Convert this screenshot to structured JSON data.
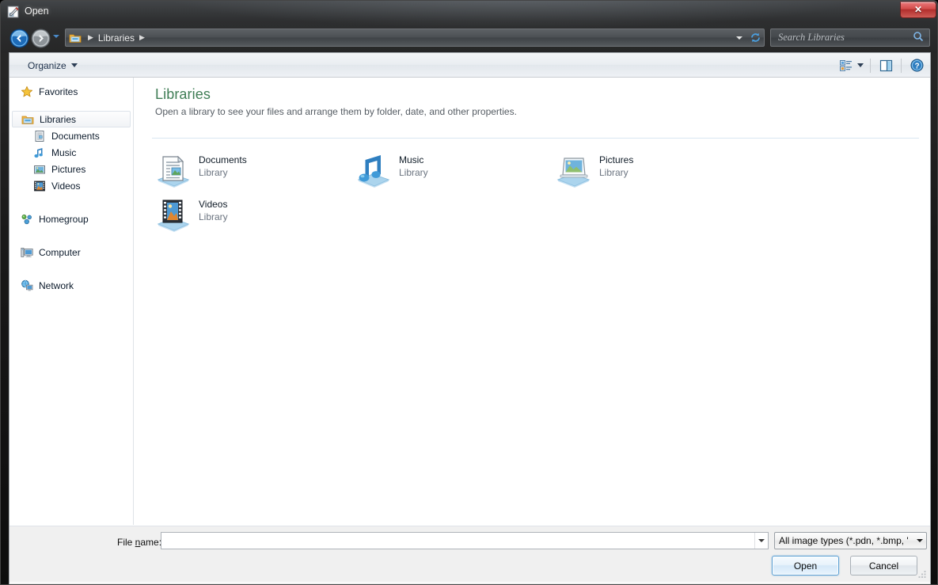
{
  "window": {
    "title": "Open",
    "title_icon": "paint-dot-net-icon",
    "close_label": "✕"
  },
  "navigation": {
    "back_icon": "back-arrow-icon",
    "forward_icon": "forward-arrow-icon",
    "history_dropdown_icon": "chevron-down-icon",
    "breadcrumb_folder_icon": "library-folder-icon",
    "breadcrumb": [
      {
        "label": "Libraries"
      }
    ],
    "separator": "▶",
    "address_dropdown_icon": "chevron-down-icon",
    "refresh_icon": "refresh-icon"
  },
  "search": {
    "placeholder": "Search Libraries",
    "value": "",
    "icon": "search-icon"
  },
  "toolbar": {
    "organize_label": "Organize",
    "organize_caret_icon": "chevron-down-icon",
    "view_icon": "change-view-icon",
    "view_caret_icon": "chevron-down-icon",
    "preview_pane_icon": "preview-pane-icon",
    "help_icon": "help-icon"
  },
  "sidebar": {
    "items": [
      {
        "label": "Favorites",
        "icon": "star-icon",
        "level": 0,
        "selected": false,
        "gap_before": false
      },
      {
        "label": "Libraries",
        "icon": "library-folder-icon",
        "level": 0,
        "selected": true,
        "gap_before": true
      },
      {
        "label": "Documents",
        "icon": "documents-library-icon",
        "level": 1,
        "selected": false,
        "gap_before": false
      },
      {
        "label": "Music",
        "icon": "music-library-icon",
        "level": 1,
        "selected": false,
        "gap_before": false
      },
      {
        "label": "Pictures",
        "icon": "pictures-library-icon",
        "level": 1,
        "selected": false,
        "gap_before": false
      },
      {
        "label": "Videos",
        "icon": "videos-library-icon",
        "level": 1,
        "selected": false,
        "gap_before": false
      },
      {
        "label": "Homegroup",
        "icon": "homegroup-icon",
        "level": 0,
        "selected": false,
        "gap_before": true
      },
      {
        "label": "Computer",
        "icon": "computer-icon",
        "level": 0,
        "selected": false,
        "gap_before": true
      },
      {
        "label": "Network",
        "icon": "network-icon",
        "level": 0,
        "selected": false,
        "gap_before": true
      }
    ]
  },
  "content": {
    "heading": "Libraries",
    "heading_color": "#3f7d55",
    "subheading": "Open a library to see your files and arrange them by folder, date, and other properties.",
    "items": [
      {
        "name": "Documents",
        "kind": "Library",
        "icon": "documents-library-icon"
      },
      {
        "name": "Music",
        "kind": "Library",
        "icon": "music-library-icon"
      },
      {
        "name": "Pictures",
        "kind": "Library",
        "icon": "pictures-library-icon"
      },
      {
        "name": "Videos",
        "kind": "Library",
        "icon": "videos-library-icon"
      }
    ]
  },
  "footer": {
    "filename_label_before": "File ",
    "filename_label_accel": "n",
    "filename_label_after": "ame:",
    "filename_value": "",
    "filename_placeholder": "",
    "filename_dropdown_icon": "chevron-down-icon",
    "filter_value": "All image types (*.pdn, *.bmp, '",
    "filter_dropdown_icon": "chevron-down-icon",
    "open_label": "Open",
    "cancel_label": "Cancel",
    "resize_grip_icon": "resize-grip-icon"
  }
}
